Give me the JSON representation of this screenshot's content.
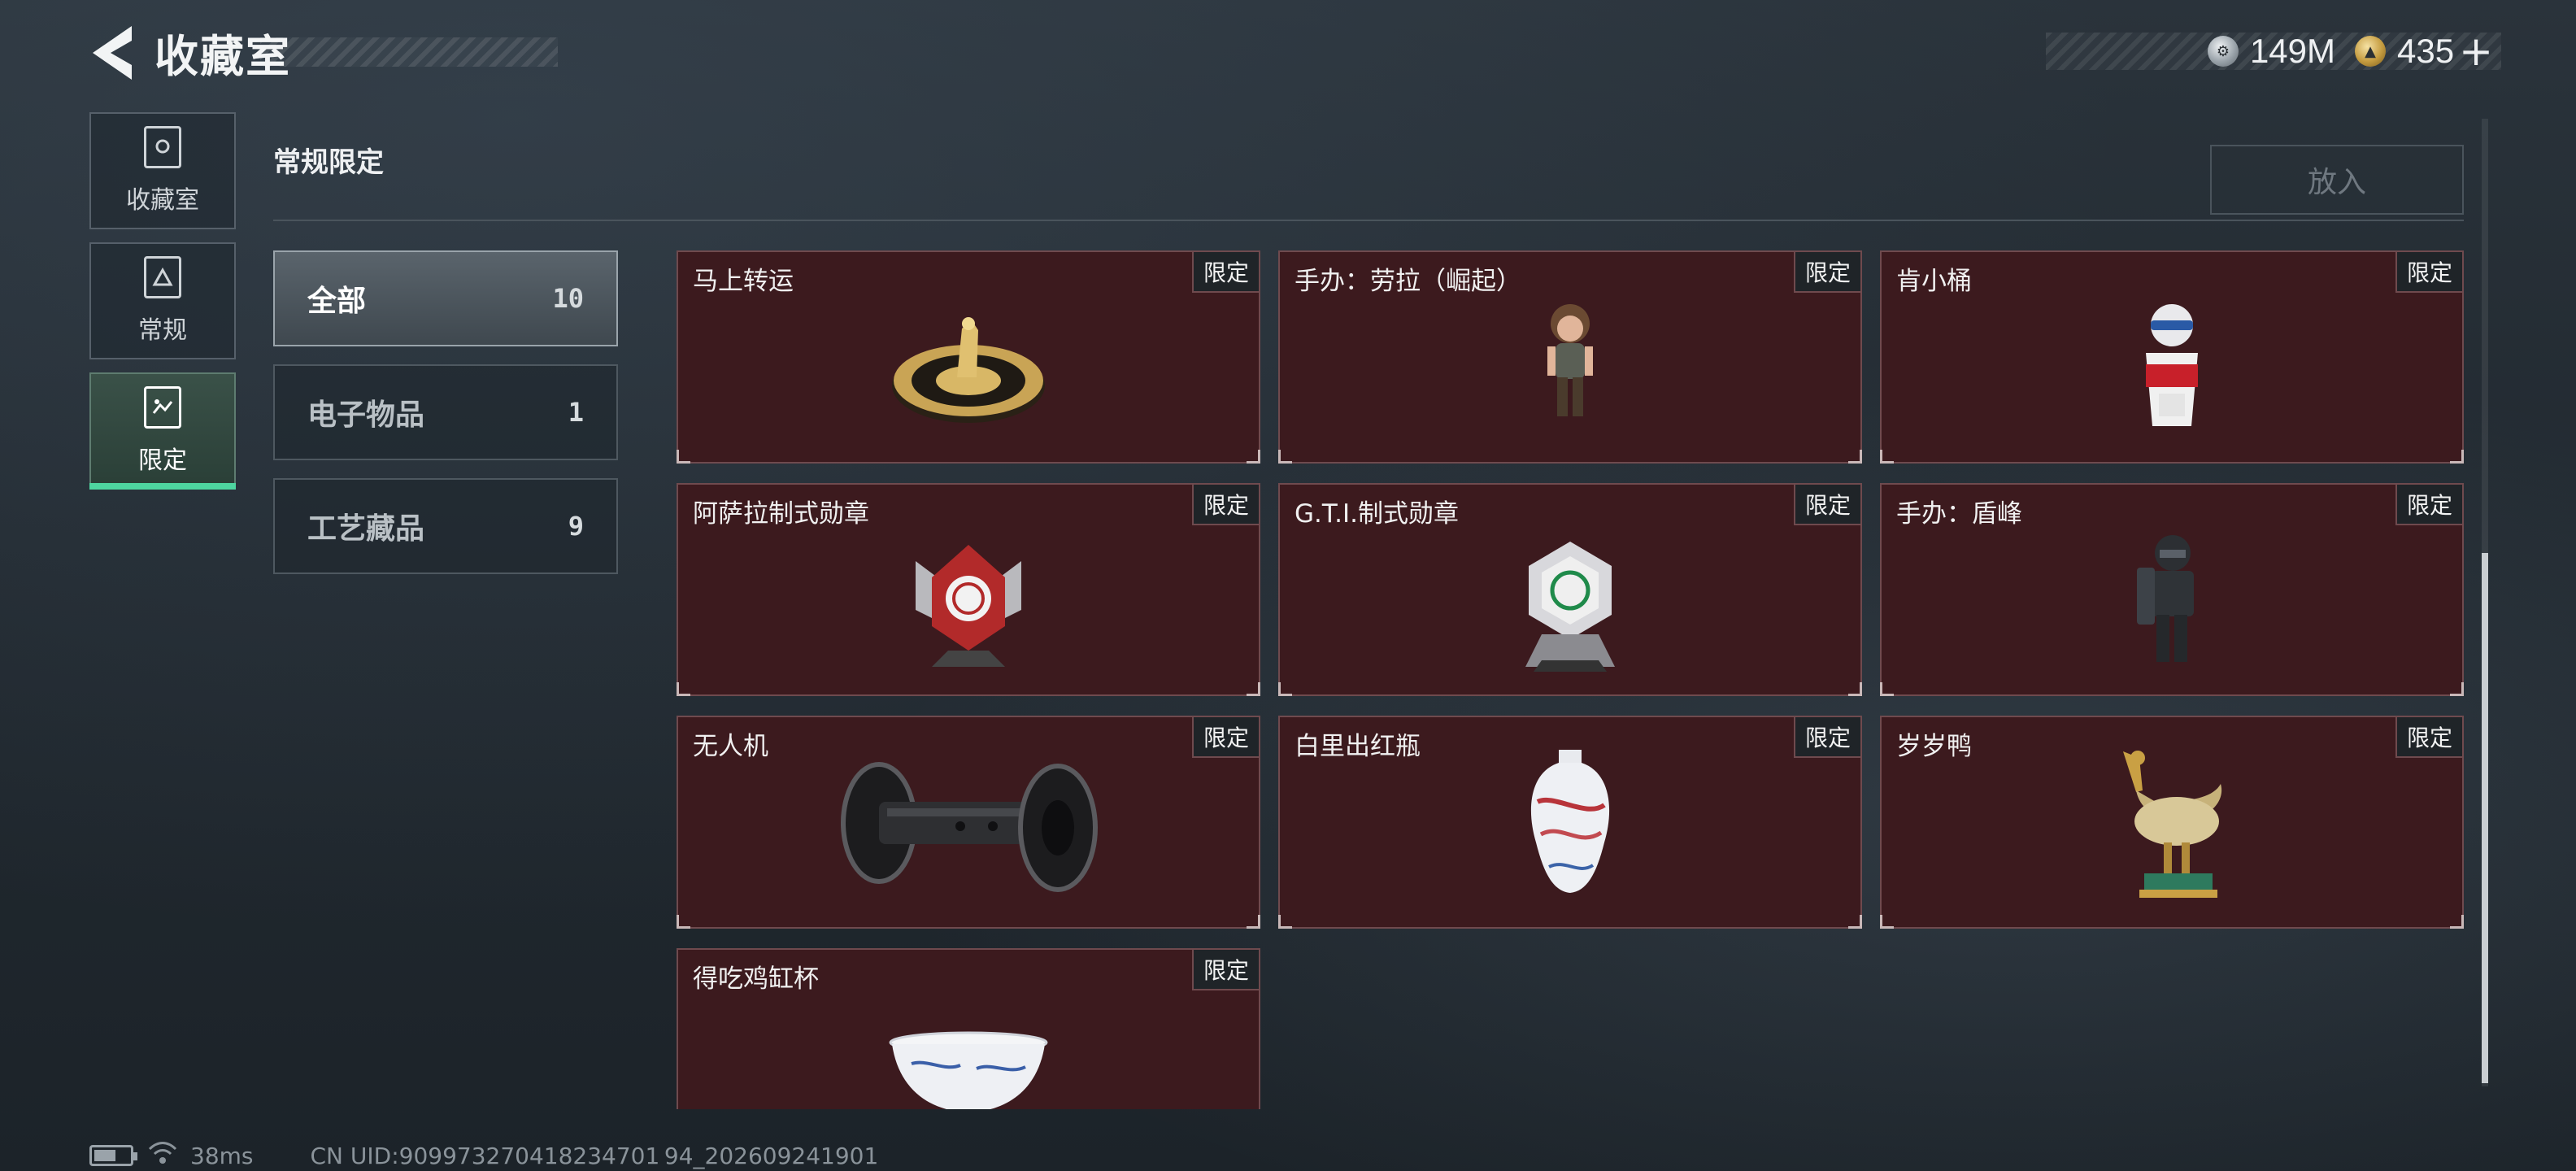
{
  "header": {
    "title": "收藏室",
    "currencies": [
      {
        "icon": "silver-coin-icon",
        "value": "149M"
      },
      {
        "icon": "gold-coin-icon",
        "value": "435"
      }
    ],
    "plus_label": "+"
  },
  "sidebar": {
    "items": [
      {
        "label": "收藏室",
        "icon": "collection-room-icon",
        "active": false
      },
      {
        "label": "常规",
        "icon": "regular-icon",
        "active": false
      },
      {
        "label": "限定",
        "icon": "limited-icon",
        "active": true
      }
    ]
  },
  "section": {
    "title": "常规限定",
    "place_button": "放入"
  },
  "filters": [
    {
      "label": "全部",
      "count": "10",
      "active": true
    },
    {
      "label": "电子物品",
      "count": "1",
      "active": false
    },
    {
      "label": "工艺藏品",
      "count": "9",
      "active": false
    }
  ],
  "items": [
    {
      "name": "马上转运",
      "badge": "限定",
      "art": "horse-medallion-icon"
    },
    {
      "name": "手办：劳拉（崛起）",
      "badge": "限定",
      "art": "lara-figure-icon"
    },
    {
      "name": "肯小桶",
      "badge": "限定",
      "art": "kfc-bucket-figure-icon"
    },
    {
      "name": "阿萨拉制式勋章",
      "badge": "限定",
      "art": "asala-medal-icon"
    },
    {
      "name": "G.T.I.制式勋章",
      "badge": "限定",
      "art": "gti-medal-icon"
    },
    {
      "name": "手办：盾峰",
      "badge": "限定",
      "art": "shield-figure-icon"
    },
    {
      "name": "无人机",
      "badge": "限定",
      "art": "drone-roller-icon"
    },
    {
      "name": "白里出红瓶",
      "badge": "限定",
      "art": "porcelain-vase-icon"
    },
    {
      "name": "岁岁鸭",
      "badge": "限定",
      "art": "bronze-duck-icon"
    },
    {
      "name": "得吃鸡缸杯",
      "badge": "限定",
      "art": "chicken-cup-icon"
    }
  ],
  "footer": {
    "ping": "38ms",
    "uid": "CN UID:909973270418234701 94_202609241901"
  },
  "colors": {
    "accent": "#4ed6a0",
    "card_bg": "#3c1a1e",
    "card_border": "#6f4a4e"
  }
}
